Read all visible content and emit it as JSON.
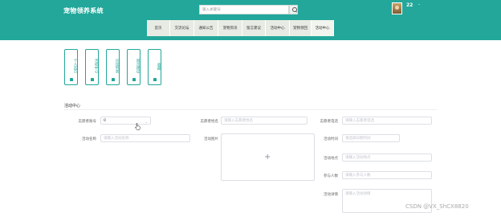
{
  "header": {
    "site_title": "宠物领养系统",
    "search_placeholder": "输入关键词",
    "user_name": "22",
    "user_menu_dot": "-"
  },
  "nav": [
    {
      "label": "首页",
      "active": false
    },
    {
      "label": "交流论坛",
      "active": false
    },
    {
      "label": "通知公告",
      "active": false
    },
    {
      "label": "宠物资讯",
      "active": false
    },
    {
      "label": "留言建议",
      "active": false
    },
    {
      "label": "活动中心",
      "active": false
    },
    {
      "label": "宠物领回",
      "active": false
    },
    {
      "label": "活动中心",
      "active": true
    }
  ],
  "side_cards": [
    {
      "label": "个人首页"
    },
    {
      "label": "活动中心"
    },
    {
      "label": "论坛列表"
    },
    {
      "label": "留言建议"
    },
    {
      "label": "收藏"
    }
  ],
  "section_title": "活动中心",
  "form": {
    "volunteer_id_label": "志愿者账号",
    "volunteer_id_value": "0",
    "volunteer_name_label": "志愿者姓名",
    "volunteer_name_placeholder": "请输入志愿者姓名",
    "volunteer_phone_label": "志愿者电话",
    "volunteer_phone_placeholder": "请输入志愿者电话",
    "activity_name_label": "活动名称",
    "activity_name_placeholder": "请输入活动名称",
    "activity_image_label": "活动图片",
    "upload_plus": "+",
    "activity_time_label": "活动时间",
    "activity_time_placeholder": "请选择日期时间",
    "activity_location_label": "活动地点",
    "activity_location_placeholder": "请输入活动地点",
    "participants_label": "参与人数",
    "participants_placeholder": "请输入参与人数",
    "activity_detail_label": "活动详情",
    "activity_detail_placeholder": "请输入活动详情"
  },
  "watermark": "CSDN @VX_ShCX8820"
}
